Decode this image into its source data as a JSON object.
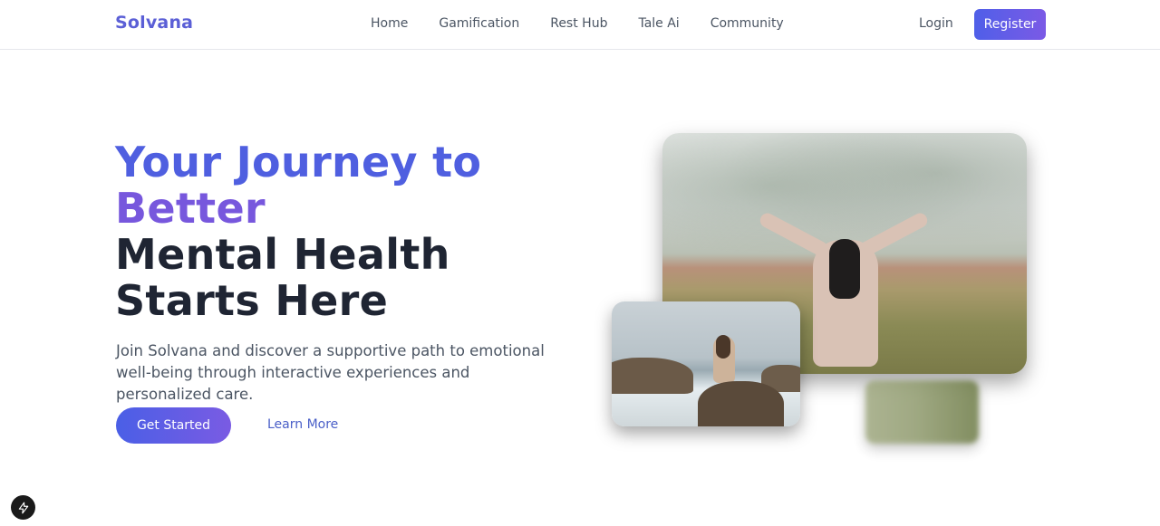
{
  "brand": {
    "name": "Solvana"
  },
  "nav": {
    "links": [
      "Home",
      "Gamification",
      "Rest Hub",
      "Tale Ai",
      "Community"
    ],
    "login": "Login",
    "register": "Register"
  },
  "hero": {
    "title_line1": "Your Journey to",
    "title_line2": "Better",
    "title_line3": "Mental Health",
    "title_line4": "Starts Here",
    "subtitle": "Join Solvana and discover a supportive path to emotional well-being through interactive experiences and personalized care.",
    "primary_cta": "Get Started",
    "secondary_cta": "Learn More"
  },
  "colors": {
    "brand": "#5b5fd6",
    "accent_blue": "#4f5fe0",
    "accent_purple": "#7757dd",
    "text_dark": "#1f2533"
  },
  "icons": {
    "badge": "bolt-icon"
  }
}
